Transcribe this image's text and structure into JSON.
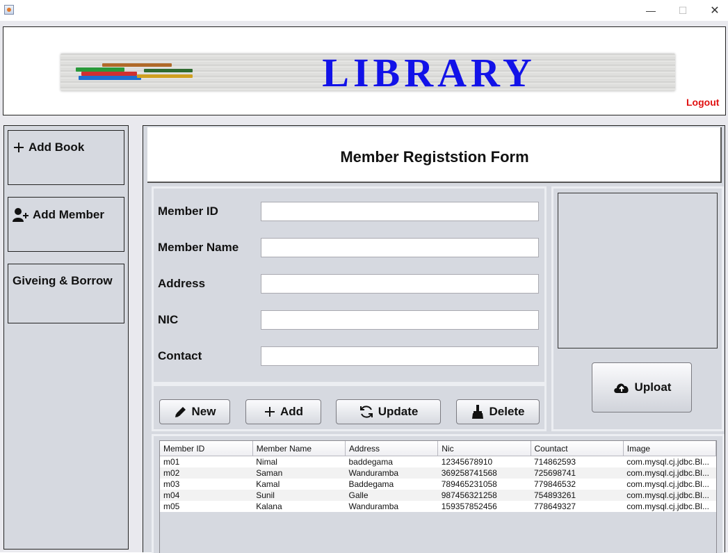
{
  "window": {
    "minimize_glyph": "—",
    "maximize_glyph": "☐",
    "close_glyph": "✕"
  },
  "header": {
    "banner_title": "LIBRARY",
    "logout_label": "Logout"
  },
  "sidebar": {
    "items": [
      {
        "label": "Add Book",
        "icon": "plus-icon"
      },
      {
        "label": "Add Member",
        "icon": "user-plus-icon"
      },
      {
        "label": "Giveing & Borrow",
        "icon": ""
      }
    ]
  },
  "form": {
    "title": "Member Registstion Form",
    "fields": [
      {
        "label": "Member ID",
        "value": ""
      },
      {
        "label": "Member Name",
        "value": ""
      },
      {
        "label": "Address",
        "value": ""
      },
      {
        "label": "NIC",
        "value": ""
      },
      {
        "label": "Contact",
        "value": ""
      }
    ]
  },
  "buttons": {
    "new_label": "New",
    "add_label": "Add",
    "update_label": "Update",
    "delete_label": "Delete",
    "upload_label": "Uploat"
  },
  "icons": {
    "new": "pencil-icon",
    "add": "plus-icon",
    "update": "refresh-icon",
    "delete": "broom-icon",
    "upload": "cloud-upload-icon"
  },
  "table": {
    "columns": [
      "Member ID",
      "Member Name",
      "Address",
      "Nic",
      "Countact",
      "Image"
    ],
    "rows": [
      [
        "m01",
        "Nimal",
        "baddegama",
        "12345678910",
        "714862593",
        "com.mysql.cj.jdbc.Bl..."
      ],
      [
        "m02",
        "Saman",
        "Wanduramba",
        "369258741568",
        "725698741",
        "com.mysql.cj.jdbc.Bl..."
      ],
      [
        "m03",
        "Kamal",
        "Baddegama",
        "789465231058",
        "779846532",
        "com.mysql.cj.jdbc.Bl..."
      ],
      [
        "m04",
        "Sunil",
        "Galle",
        "987456321258",
        "754893261",
        "com.mysql.cj.jdbc.Bl..."
      ],
      [
        "m05",
        "Kalana",
        "Wanduramba",
        "159357852456",
        "778649327",
        "com.mysql.cj.jdbc.Bl..."
      ]
    ]
  },
  "colors": {
    "banner_text": "#1212e8",
    "logout_text": "#e01010",
    "panel_bg": "#d6d9e0"
  }
}
